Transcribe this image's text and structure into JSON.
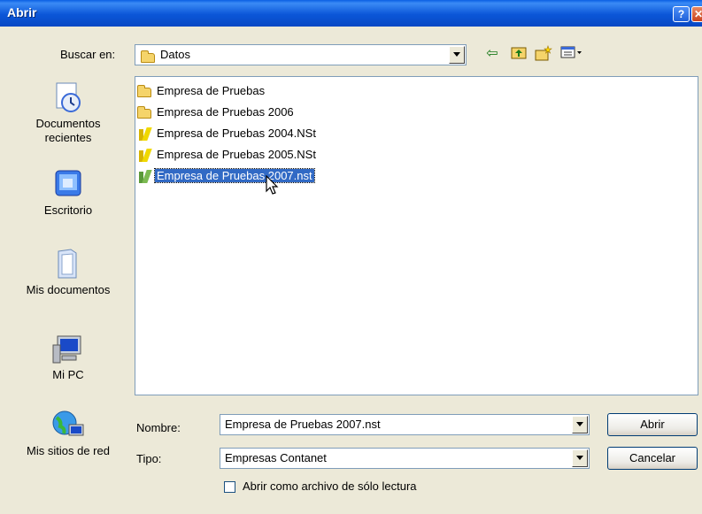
{
  "window": {
    "title": "Abrir",
    "help_label": "?",
    "close_label": "✕"
  },
  "lookin": {
    "label": "Buscar en:",
    "value": "Datos"
  },
  "toolbar": {
    "back": "⇦",
    "up": "⮤",
    "newfolder": "✳",
    "views": "▦▾"
  },
  "sidebar": {
    "items": [
      {
        "label": "Documentos recientes",
        "icon": "recent-documents-icon"
      },
      {
        "label": "Escritorio",
        "icon": "desktop-icon"
      },
      {
        "label": "Mis documentos",
        "icon": "my-documents-icon"
      },
      {
        "label": "Mi PC",
        "icon": "my-computer-icon"
      },
      {
        "label": "Mis sitios de red",
        "icon": "network-places-icon"
      }
    ]
  },
  "files": [
    {
      "name": "Empresa de Pruebas",
      "type": "folder"
    },
    {
      "name": "Empresa de Pruebas 2006",
      "type": "folder"
    },
    {
      "name": "Empresa de Pruebas 2004.NSt",
      "type": "nst"
    },
    {
      "name": "Empresa de Pruebas 2005.NSt",
      "type": "nst"
    },
    {
      "name": "Empresa de Pruebas 2007.nst",
      "type": "nst-selected"
    }
  ],
  "filename": {
    "label": "Nombre:",
    "value": "Empresa de Pruebas 2007.nst"
  },
  "filetype": {
    "label": "Tipo:",
    "value": "Empresas Contanet"
  },
  "buttons": {
    "open": "Abrir",
    "cancel": "Cancelar"
  },
  "readonly": {
    "label": "Abrir como archivo de sólo lectura",
    "checked": false
  },
  "colors": {
    "titlebar": "#0a5fe3",
    "selection": "#316ac5",
    "face": "#ece9d8"
  }
}
